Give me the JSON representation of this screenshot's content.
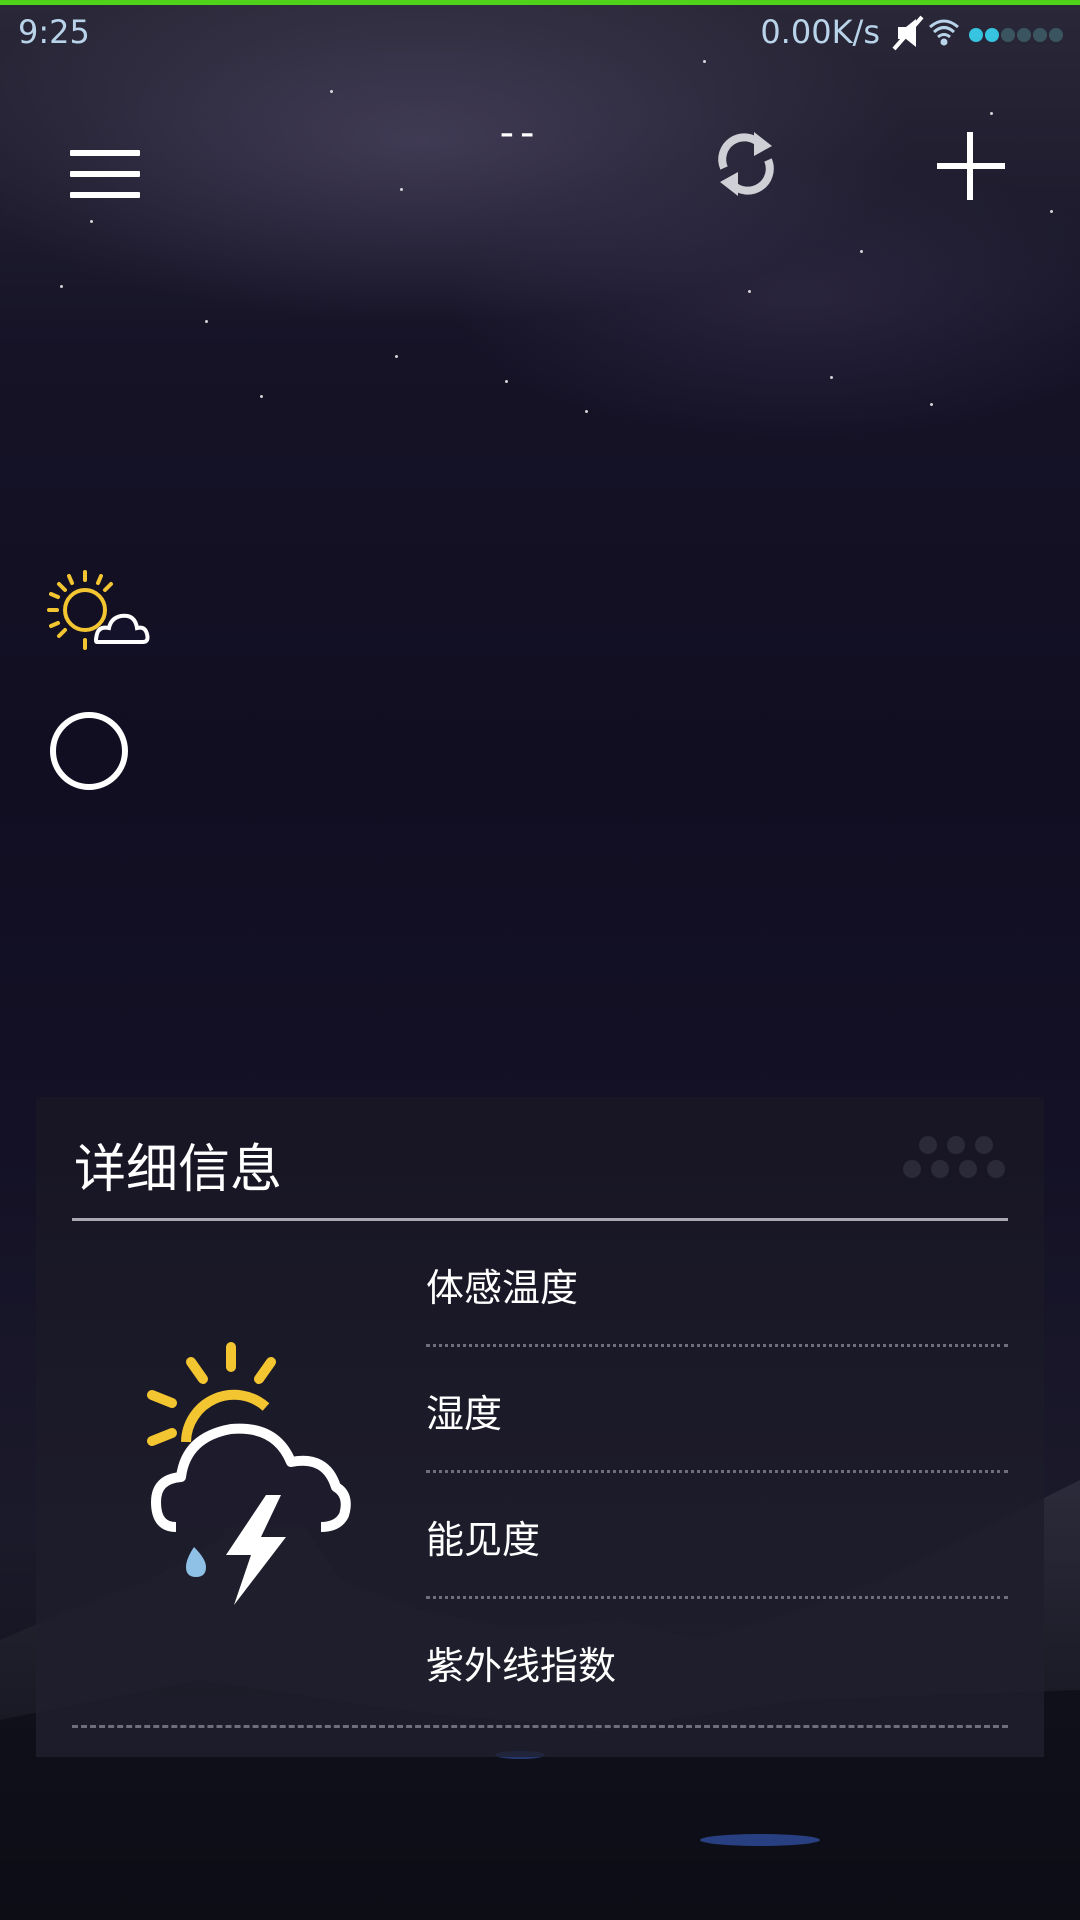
{
  "status_bar": {
    "time": "9:25",
    "network_speed": "0.00K/s",
    "icons": [
      "mute-icon",
      "wifi-icon",
      "signal-icon"
    ]
  },
  "toolbar": {
    "city_title": "--",
    "icons": [
      "menu-icon",
      "refresh-icon",
      "add-icon"
    ]
  },
  "current": {
    "condition_icon": "partly-cloudy-icon",
    "temperature_icon": "ring-icon"
  },
  "details": {
    "title": "详细信息",
    "icon": "thunderstorm-sun-icon",
    "rows": [
      {
        "label": "体感温度"
      },
      {
        "label": "湿度"
      },
      {
        "label": "能见度"
      },
      {
        "label": "紫外线指数"
      }
    ]
  },
  "colors": {
    "accent_bar": "#4fd21a",
    "sun": "#f2c531",
    "status_text": "#b9d4ea",
    "raindrop": "#8fc0e6"
  }
}
